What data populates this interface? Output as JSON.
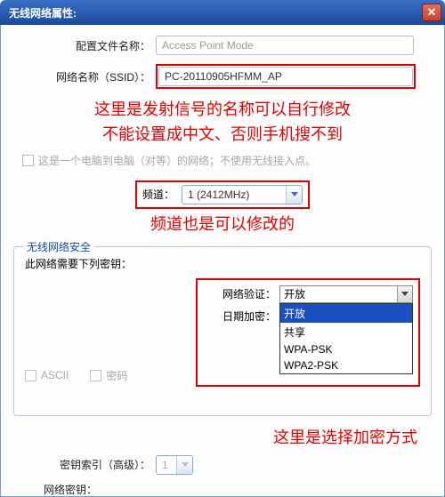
{
  "titlebar": {
    "title": "无线网络属性:"
  },
  "form": {
    "profile_name_label": "配置文件名称：",
    "profile_name_value": "Access Point Mode",
    "ssid_label": "网络名称（SSID）：",
    "ssid_value": "PC-20110905HFMM_AP",
    "adhoc_checkbox_label": "这是一个电脑到电脑（对等）的网络；不使用无线接入点。",
    "channel_label": "频道：",
    "channel_value": "1 (2412MHz)"
  },
  "security": {
    "legend": "无线网络安全",
    "require_key_label": "此网络需要下列密钥：",
    "auth_label": "网络验证：",
    "auth_value": "开放",
    "auth_options": [
      "开放",
      "共享",
      "WPA-PSK",
      "WPA2-PSK"
    ],
    "encrypt_label": "日期加密：",
    "ascii_label": "ASCII",
    "password_label": "密码",
    "key_index_label": "密钥索引（高级）：",
    "key_index_value": "1",
    "network_key_label": "网络密钥："
  },
  "annotations": {
    "ssid_note_line1": "这里是发射信号的名称可以自行修改",
    "ssid_note_line2": "不能设置成中文、否则手机搜不到",
    "channel_note": "频道也是可以修改的",
    "encrypt_note": "这里是选择加密方式"
  }
}
